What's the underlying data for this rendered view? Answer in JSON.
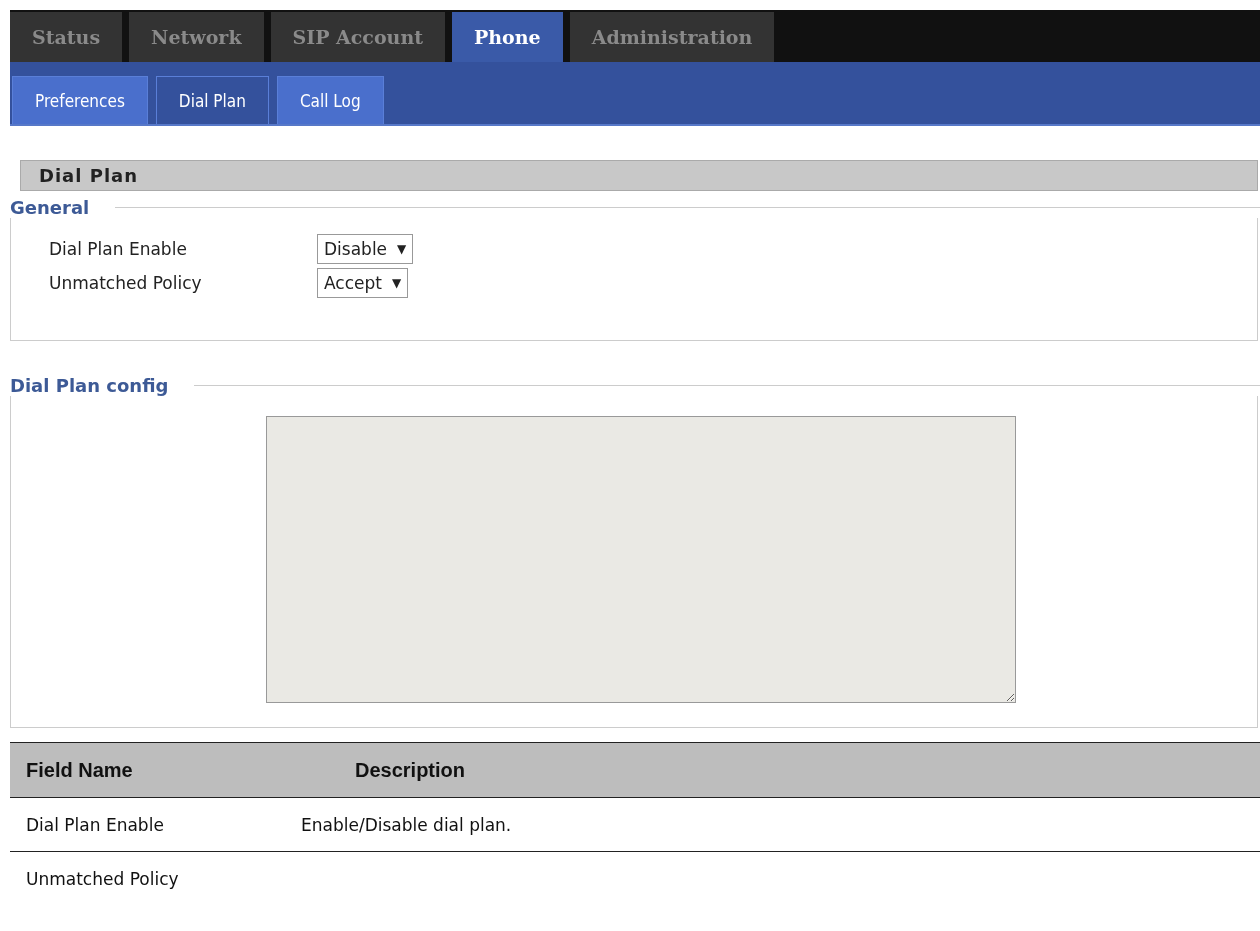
{
  "tabs": [
    {
      "label": "Status",
      "selected": false
    },
    {
      "label": "Network",
      "selected": false
    },
    {
      "label": "SIP Account",
      "selected": false
    },
    {
      "label": "Phone",
      "selected": true
    },
    {
      "label": "Administration",
      "selected": false
    }
  ],
  "subtabs": [
    {
      "label": "Preferences",
      "selected": false
    },
    {
      "label": "Dial Plan",
      "selected": true
    },
    {
      "label": "Call Log",
      "selected": false
    }
  ],
  "section_title": "Dial Plan",
  "general": {
    "legend": "General",
    "fields": [
      {
        "label": "Dial Plan Enable",
        "value": "Disable",
        "arrow": "▼"
      },
      {
        "label": "Unmatched Policy",
        "value": "Accept",
        "arrow": "▼"
      }
    ]
  },
  "config": {
    "legend": "Dial Plan config"
  },
  "table": {
    "columns": [
      "Field Name",
      "Description"
    ],
    "rows": [
      {
        "field_name": "Dial Plan Enable",
        "description": "Enable/Disable dial plan."
      },
      {
        "field_name": "Unmatched Policy"
      }
    ]
  }
}
